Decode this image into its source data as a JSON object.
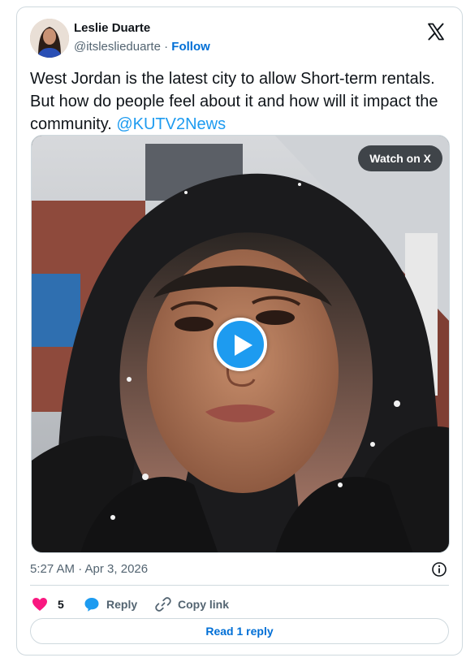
{
  "author": {
    "display_name": "Leslie Duarte",
    "handle": "@itslesliedu​arte",
    "separator": " · ",
    "follow_label": "Follow"
  },
  "logo_icon": "x-logo-icon",
  "tweet": {
    "text": "West Jordan is the latest city to allow Short-term rentals. But how do people feel about it and how will it impact the community. ",
    "mention": "@KUTV2News"
  },
  "media": {
    "watch_label": "Watch on X",
    "play_icon": "play-icon"
  },
  "meta": {
    "timestamp": "5:27 AM · Apr 3, 2026",
    "info_icon": "info-icon"
  },
  "actions": {
    "like_count": "5",
    "reply_label": "Reply",
    "copy_label": "Copy link"
  },
  "read_reply_label": "Read 1 reply",
  "colors": {
    "accent": "#1d9bf0",
    "link": "#006fd6",
    "like": "#f91880",
    "muted": "#536471",
    "border": "#cfd9de"
  }
}
